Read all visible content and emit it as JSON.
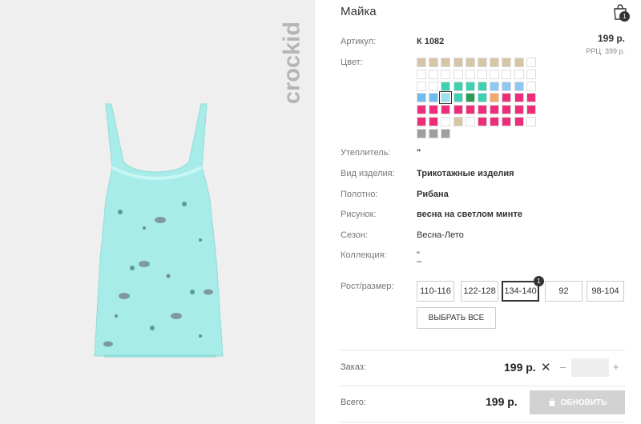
{
  "product": {
    "title": "Майка",
    "brand": "crockid",
    "price": "199 р.",
    "rrp": "РРЦ: 399 р."
  },
  "cart": {
    "icon": "shopping-bag-icon",
    "count": "1"
  },
  "details": {
    "article_label": "Артикул:",
    "article_value": "К 1082",
    "color_label": "Цвет:",
    "insulation_label": "Утеплитель:",
    "insulation_value": "\"",
    "type_label": "Вид изделия:",
    "type_value": "Трикотажные изделия",
    "fabric_label": "Полотно:",
    "fabric_value": "Рибана",
    "pattern_label": "Рисунок:",
    "pattern_value": "весна на светлом минте",
    "season_label": "Сезон:",
    "season_value": "Весна-Лето",
    "collection_label": "Коллекция:",
    "collection_value_1": "\"",
    "collection_value_2": "–"
  },
  "swatch_colors": [
    [
      "#d6c6a6",
      "#d6c6a6",
      "#d6c6a6",
      "#d6c6a6",
      "#d6c6a6",
      "#d6c6a6",
      "#d6c6a6",
      "#d6c6a6",
      "#d6c6a6",
      "#ffffff"
    ],
    [
      "#ffffff",
      "#ffffff",
      "#ffffff",
      "#ffffff",
      "#ffffff",
      "#ffffff",
      "#ffffff",
      "#ffffff",
      "#ffffff",
      "#ffffff"
    ],
    [
      "#ffffff",
      "#ffffff",
      "#3dd0b2",
      "#3dd0b2",
      "#3dd0b2",
      "#3dd0b2",
      "#8cc8f2",
      "#8cc8f2",
      "#8cc8f2",
      "#ffffff"
    ],
    [
      "#6fbcf0",
      "#6fbcf0",
      "#9fe0ee",
      "#3dd0b2",
      "#2a9a55",
      "#3dd0b2",
      "#f3a86a",
      "#ee2d7a",
      "#ee2d7a",
      "#ee2d7a"
    ],
    [
      "#ee2d7a",
      "#ee2d7a",
      "#ee2d7a",
      "#ee2d7a",
      "#ee2d7a",
      "#ee2d7a",
      "#ee2d7a",
      "#ee2d7a",
      "#ee2d7a",
      "#ee2d7a"
    ],
    [
      "#ee2d7a",
      "#ee2d7a",
      "#ffffff",
      "#d6c6a6",
      "#ffffff",
      "#ee2d7a",
      "#ee2d7a",
      "#ee2d7a",
      "#ee2d7a",
      "#ffffff"
    ],
    [
      "#9e9e9e",
      "#9e9e9e",
      "#9e9e9e"
    ]
  ],
  "size_section": {
    "label": "Рост/размер:",
    "sizes": [
      "110-116",
      "122-128",
      "134-140",
      "92",
      "98-104"
    ],
    "selected_badge": "1",
    "select_all": "ВЫБРАТЬ ВСЕ"
  },
  "order": {
    "label": "Заказ:",
    "price": "199 р.",
    "times": "✕",
    "minus": "–",
    "plus": "+",
    "quantity": ""
  },
  "total": {
    "label": "Всего:",
    "price": "199 р.",
    "update_button": "ОБНОВИТЬ",
    "update_icon": "bag-icon"
  }
}
